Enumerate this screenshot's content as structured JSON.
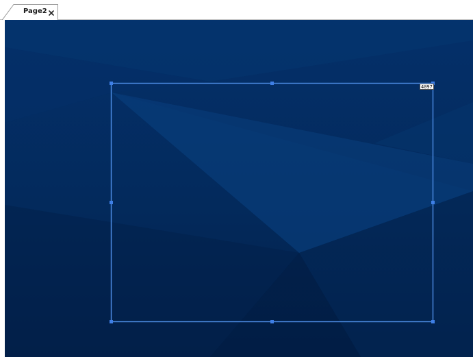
{
  "tabs": [
    {
      "label": "Page2",
      "close_icon": "close-icon",
      "active": true
    }
  ],
  "selection": {
    "badge_text": "4097"
  },
  "colors": {
    "canvas_base": "#042a5e",
    "selection_stroke": "#4f8fe8",
    "handle_fill": "#3f7fe6"
  }
}
